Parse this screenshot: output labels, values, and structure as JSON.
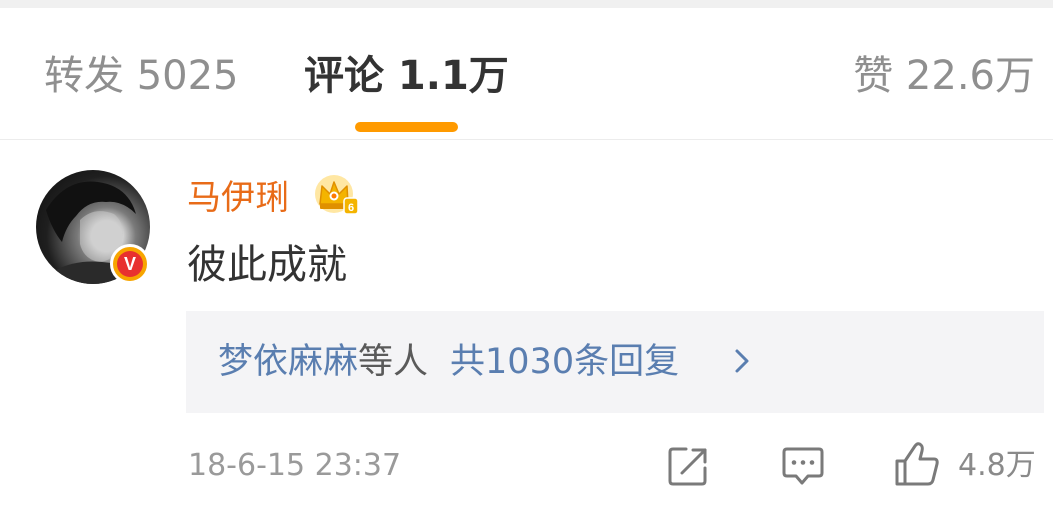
{
  "tabs": {
    "repost": "转发 5025",
    "comments": "评论 1.1万",
    "likes": "赞 22.6万",
    "active_color": "#ff9a00"
  },
  "comment": {
    "username": "马伊琍",
    "username_color": "#e86b18",
    "badge_icon": "vip-crown-icon",
    "badge_level": "6",
    "verified_icon": "verified-v-icon",
    "verified_letter": "V",
    "text": "彼此成就",
    "replies": {
      "replier": "梦依麻麻",
      "replier_suffix": "等人",
      "count_text": "共1030条回复",
      "chevron_icon": "chevron-right-icon"
    },
    "timestamp": "18-6-15 23:37",
    "actions": {
      "share_icon": "share-icon",
      "comment_icon": "comment-bubble-icon",
      "like_icon": "thumbs-up-icon",
      "like_count": "4.8万"
    }
  }
}
